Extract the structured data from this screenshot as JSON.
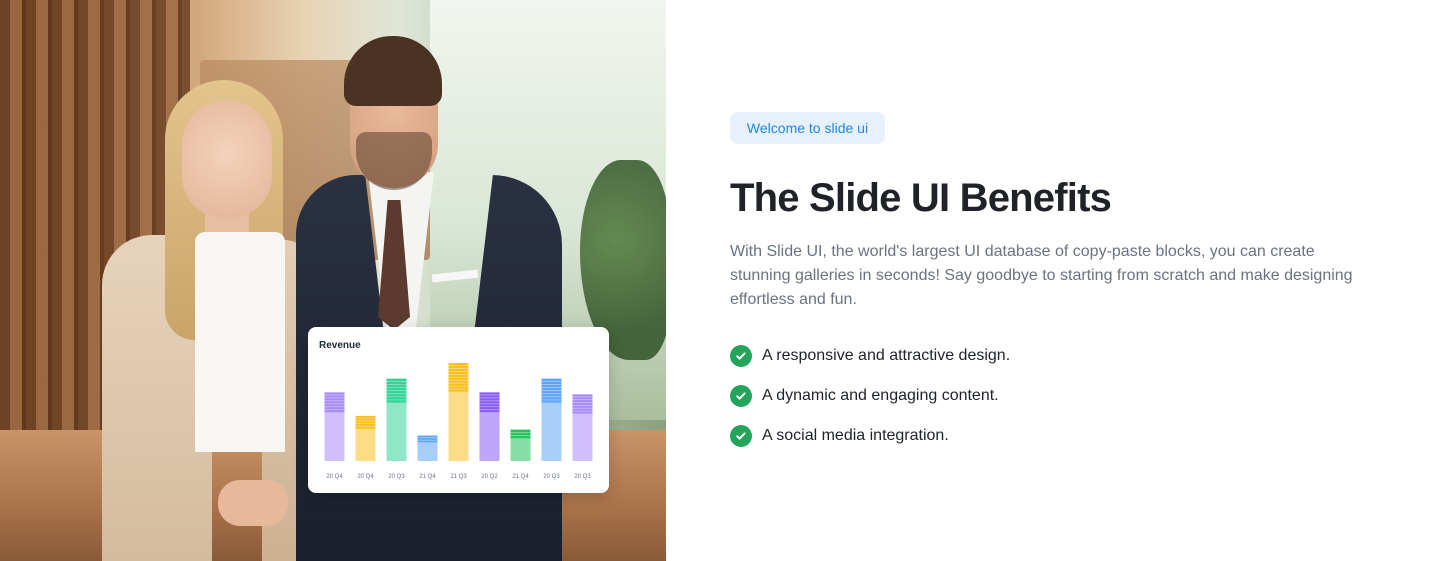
{
  "colors": {
    "badge_bg": "#e6f1fc",
    "badge_text": "#1e88e5",
    "check": "#22a55b",
    "heading": "#1f2328",
    "description": "#6b7280"
  },
  "hero_image": {
    "revenue_card": {
      "title": "Revenue",
      "chart_data": {
        "type": "bar",
        "categories": [
          "20 Q4",
          "20 Q4",
          "20 Q3",
          "21 Q4",
          "21 Q3",
          "20 Q2",
          "21 Q4",
          "20 Q3",
          "20 Q3"
        ],
        "values": [
          70,
          46,
          84,
          26,
          100,
          70,
          32,
          84,
          68
        ],
        "colors": [
          "#a78bfa",
          "#fbbf24",
          "#34d399",
          "#60a5fa",
          "#fbbf24",
          "#8b5cf6",
          "#22c55e",
          "#60a5fa",
          "#a78bfa"
        ],
        "title": "Revenue",
        "xlabel": "",
        "ylabel": "",
        "grid": false
      }
    }
  },
  "content": {
    "badge": "Welcome to slide ui",
    "heading": "The Slide UI Benefits",
    "description": "With Slide UI, the world's largest UI database of copy-paste blocks, you can create stunning galleries in seconds! Say goodbye to starting from scratch and make designing effortless and fun.",
    "benefits": [
      {
        "icon": "check-circle-icon",
        "label": "A responsive and attractive design."
      },
      {
        "icon": "check-circle-icon",
        "label": "A dynamic and engaging content."
      },
      {
        "icon": "check-circle-icon",
        "label": "A social media integration."
      }
    ]
  }
}
